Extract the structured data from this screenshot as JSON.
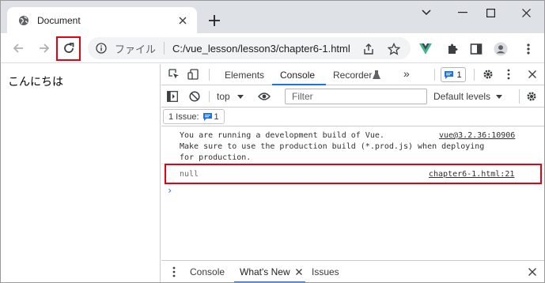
{
  "browser": {
    "tab_title": "Document",
    "omnibox": {
      "scheme_label": "ファイル",
      "url": "C:/vue_lesson/lesson3/chapter6-1.html"
    }
  },
  "page": {
    "text": "こんにちは"
  },
  "devtools": {
    "tabs": [
      "Elements",
      "Console",
      "Recorder"
    ],
    "active_tab": "Console",
    "issues_badge": "1",
    "context": "top",
    "filter_placeholder": "Filter",
    "levels": "Default levels",
    "issue_button": "1 Issue:",
    "issue_count": "1",
    "messages": [
      {
        "lines": [
          "You are running a development build of Vue.",
          "Make sure to use the production build (*.prod.js) when deploying",
          "for production."
        ],
        "source": "vue@3.2.36:10906"
      },
      {
        "text": "null",
        "source": "chapter6-1.html:21"
      }
    ],
    "prompt": "›",
    "drawer_tabs": [
      "Console",
      "What's New",
      "Issues"
    ],
    "drawer_active": "What's New"
  },
  "colors": {
    "accent": "#1a73e8",
    "highlight": "#e60012",
    "vue_green": "#41b883"
  }
}
